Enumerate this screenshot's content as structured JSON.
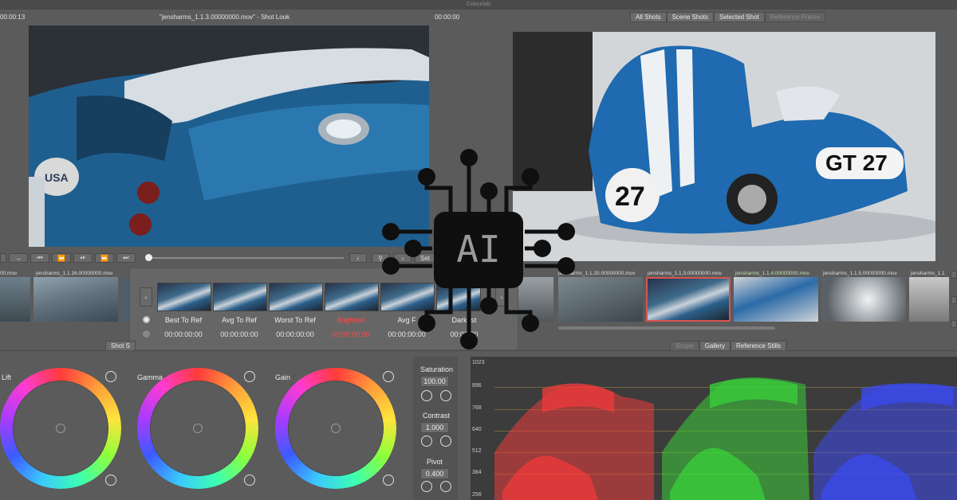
{
  "app": {
    "title": "Colourlab"
  },
  "left_viewer": {
    "timecode_start": "00:00:13",
    "title": "\"jensharms_1.1.3.00000000.mov\" - Shot Look",
    "timecode_end": "00:00:00"
  },
  "right_viewer": {
    "tabs": [
      "All Shots",
      "Scene Shots",
      "Selected Shot",
      "Reference Frame"
    ]
  },
  "transport": {
    "ref_button": "Set"
  },
  "thumbnails_left": [
    "jensharms_1.1.16.00000000.mov",
    "jensharms_1.1.16.00000000.mov"
  ],
  "thumbnails_left_first_label": "00.mov",
  "thumbnails_right": [
    "jensharms_1.1.20.00000000.mov",
    "jensharms_1.1.3.00000000.mov",
    "jensharms_1.1.4.00000000.mov",
    "jensharms_1.1.5.00000000.mov",
    "jensharms_1.1"
  ],
  "popup": {
    "columns": [
      {
        "label": "Best To Ref",
        "value": "00:00:00:00"
      },
      {
        "label": "Avg To Ref",
        "value": "00:00:00:00"
      },
      {
        "label": "Worst To Ref",
        "value": "00:00:00:00"
      },
      {
        "label": "Brightest",
        "value": "00:00:00:00"
      },
      {
        "label": "Avg F",
        "value": "00:00:00:00"
      },
      {
        "label": "Darkest",
        "value": "00:00:00"
      }
    ]
  },
  "bottom_left": {
    "tab": "Shot S"
  },
  "bottom_right": {
    "tabs": [
      "Scope",
      "Gallery",
      "Reference Stills"
    ]
  },
  "wheels": [
    {
      "label": "Lift"
    },
    {
      "label": "Gamma"
    },
    {
      "label": "Gain"
    }
  ],
  "side_controls": [
    {
      "label": "Saturation",
      "value": "100.00"
    },
    {
      "label": "Contrast",
      "value": "1.000"
    },
    {
      "label": "Pivot",
      "value": "0.400"
    }
  ],
  "scope": {
    "ticks": [
      "1023",
      "896",
      "768",
      "640",
      "512",
      "384",
      "256"
    ]
  },
  "overlay": {
    "text": "AI"
  },
  "colors": {
    "red_channel": "#ff3b3b",
    "green_channel": "#3bdc3b",
    "blue_channel": "#3b4bff",
    "highlight": "#ff4a4a",
    "accent_frame": "#d9534f"
  }
}
